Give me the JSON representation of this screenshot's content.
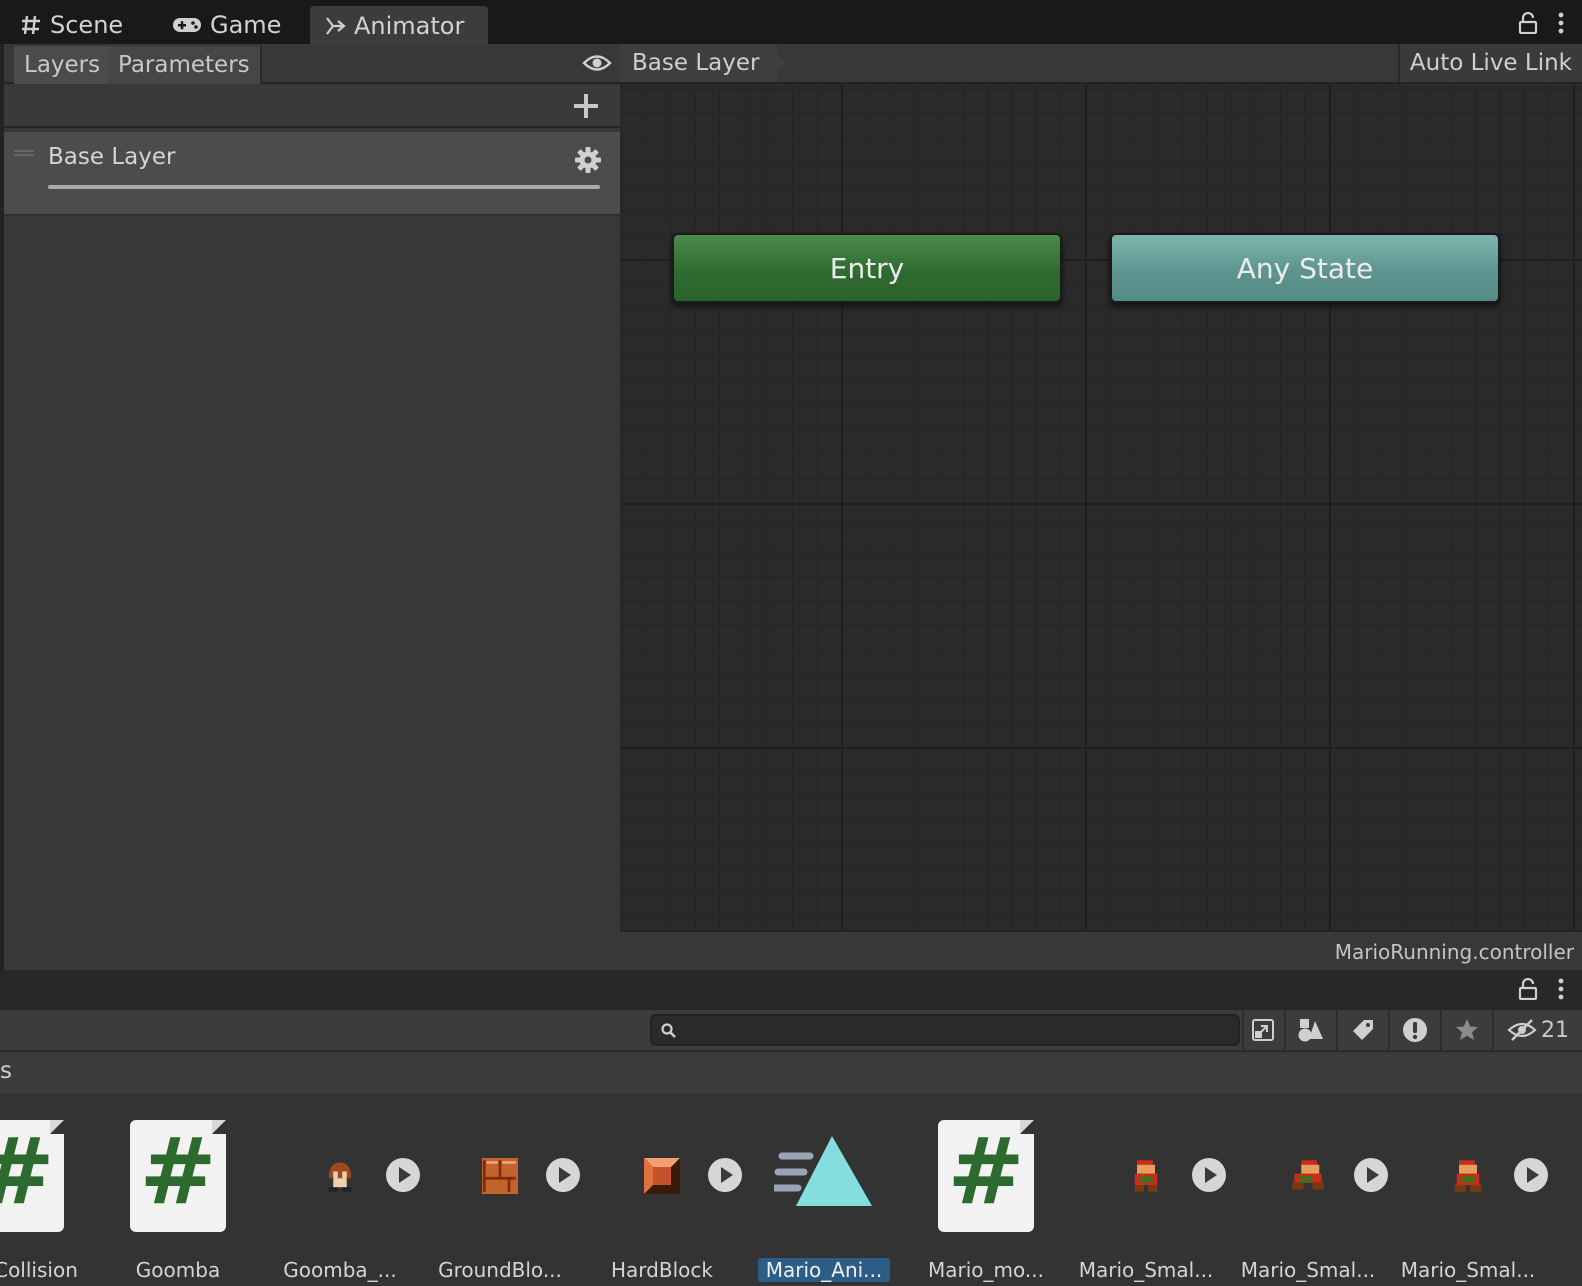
{
  "tabs": [
    {
      "label": "Scene",
      "icon": "grid-icon"
    },
    {
      "label": "Game",
      "icon": "gamepad-icon"
    },
    {
      "label": "Animator",
      "icon": "animator-icon",
      "active": true
    }
  ],
  "left_panel": {
    "tabs": [
      {
        "label": "Layers",
        "selected": true
      },
      {
        "label": "Parameters"
      }
    ],
    "layers": [
      {
        "name": "Base Layer"
      }
    ]
  },
  "graph": {
    "breadcrumb": "Base Layer",
    "auto_live_link": "Auto Live Link",
    "nodes": {
      "entry": "Entry",
      "any_state": "Any State"
    },
    "status": "MarioRunning.controller"
  },
  "project": {
    "search": {
      "placeholder": "",
      "value": ""
    },
    "hidden_count": "21",
    "folder_fragment": "s",
    "assets": [
      {
        "label": "Collision",
        "kind": "script"
      },
      {
        "label": "Goomba",
        "kind": "script"
      },
      {
        "label": "Goomba_...",
        "kind": "sprite-anim"
      },
      {
        "label": "GroundBlo...",
        "kind": "sprite-anim"
      },
      {
        "label": "HardBlock",
        "kind": "sprite-anim"
      },
      {
        "label": "Mario_Ani...",
        "kind": "animator-controller",
        "selected": true
      },
      {
        "label": "Mario_mo...",
        "kind": "script"
      },
      {
        "label": "Mario_Smal...",
        "kind": "sprite-anim"
      },
      {
        "label": "Mario_Smal...",
        "kind": "sprite-anim"
      },
      {
        "label": "Mario_Smal...",
        "kind": "sprite-anim"
      }
    ]
  },
  "colors": {
    "entry_node": "#2f6c30",
    "any_state_node": "#5e948f",
    "script_hash": "#2d6a2d",
    "selection": "#2c5d87",
    "animator_triangle": "#85dede"
  }
}
